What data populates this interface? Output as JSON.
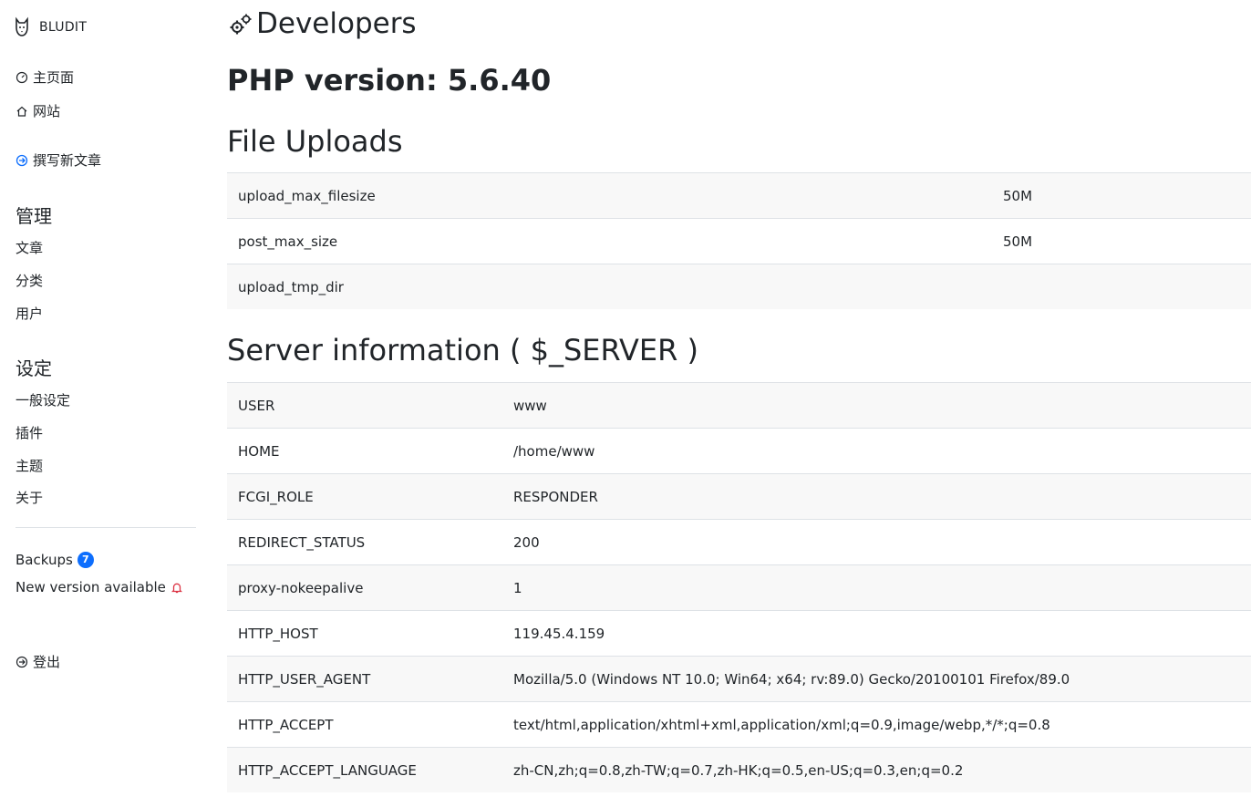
{
  "brand": {
    "name": "BLUDIT",
    "icon": "bludit-dog-logo-icon"
  },
  "sidebar": {
    "dashboard": {
      "label": "主页面",
      "icon": "dashboard-gauge-icon"
    },
    "website": {
      "label": "网站",
      "icon": "home-icon"
    },
    "new_content": {
      "label": "撰写新文章",
      "icon": "arrow-circle-right-icon"
    },
    "manage_heading": "管理",
    "manage_items": [
      {
        "label": "文章"
      },
      {
        "label": "分类"
      },
      {
        "label": "用户"
      }
    ],
    "settings_heading": "设定",
    "settings_items": [
      {
        "label": "一般设定"
      },
      {
        "label": "插件"
      },
      {
        "label": "主题"
      },
      {
        "label": "关于"
      }
    ],
    "backups": {
      "label": "Backups",
      "count": "7"
    },
    "new_version": {
      "label": "New version available",
      "icon": "bell-icon",
      "icon_color": "#dc3545"
    },
    "logout": {
      "label": "登出",
      "icon": "sign-out-icon"
    }
  },
  "main": {
    "title": "Developers",
    "title_icon": "gears-icon",
    "php_version": "PHP version: 5.6.40",
    "file_uploads": {
      "heading": "File Uploads",
      "rows": [
        {
          "key": "upload_max_filesize",
          "value": "50M"
        },
        {
          "key": "post_max_size",
          "value": "50M"
        },
        {
          "key": "upload_tmp_dir",
          "value": ""
        }
      ]
    },
    "server_info": {
      "heading": "Server information ( $_SERVER )",
      "rows": [
        {
          "key": "USER",
          "value": "www"
        },
        {
          "key": "HOME",
          "value": "/home/www"
        },
        {
          "key": "FCGI_ROLE",
          "value": "RESPONDER"
        },
        {
          "key": "REDIRECT_STATUS",
          "value": "200"
        },
        {
          "key": "proxy-nokeepalive",
          "value": "1"
        },
        {
          "key": "HTTP_HOST",
          "value": "119.45.4.159"
        },
        {
          "key": "HTTP_USER_AGENT",
          "value": "Mozilla/5.0 (Windows NT 10.0; Win64; x64; rv:89.0) Gecko/20100101 Firefox/89.0"
        },
        {
          "key": "HTTP_ACCEPT",
          "value": "text/html,application/xhtml+xml,application/xml;q=0.9,image/webp,*/*;q=0.8"
        },
        {
          "key": "HTTP_ACCEPT_LANGUAGE",
          "value": "zh-CN,zh;q=0.8,zh-TW;q=0.7,zh-HK;q=0.5,en-US;q=0.3,en;q=0.2"
        }
      ]
    }
  },
  "colors": {
    "badge": "#0d6efd",
    "alert": "#dc3545",
    "row_stripe": "#f8f8f8",
    "border": "#dee2e6"
  }
}
